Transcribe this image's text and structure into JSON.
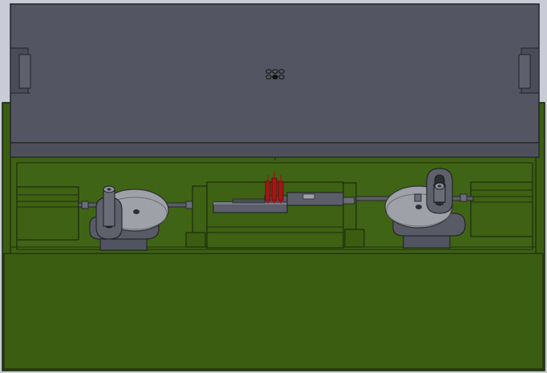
{
  "viewport": {
    "background_color": "#c9ccd6"
  },
  "model": {
    "colors": {
      "base_plate": "#3b5d12",
      "base_plate_light": "#4a7017",
      "base_outline": "#14210a",
      "cover": "#535662",
      "cover_dark": "#3e414b",
      "cover_outline": "#22242a",
      "hardware": "#5b5e68",
      "hardware_light": "#a9abb3",
      "hardware_dark": "#2c2e34",
      "pulley": "#9fa1a8",
      "pins": "#a21616",
      "pins_dark": "#5a0a0a"
    },
    "parts": [
      "top-cover",
      "base-plate",
      "left-pulley-assembly",
      "right-pulley-assembly",
      "center-slide-assembly",
      "red-probe-pins",
      "indicator-holes"
    ]
  }
}
